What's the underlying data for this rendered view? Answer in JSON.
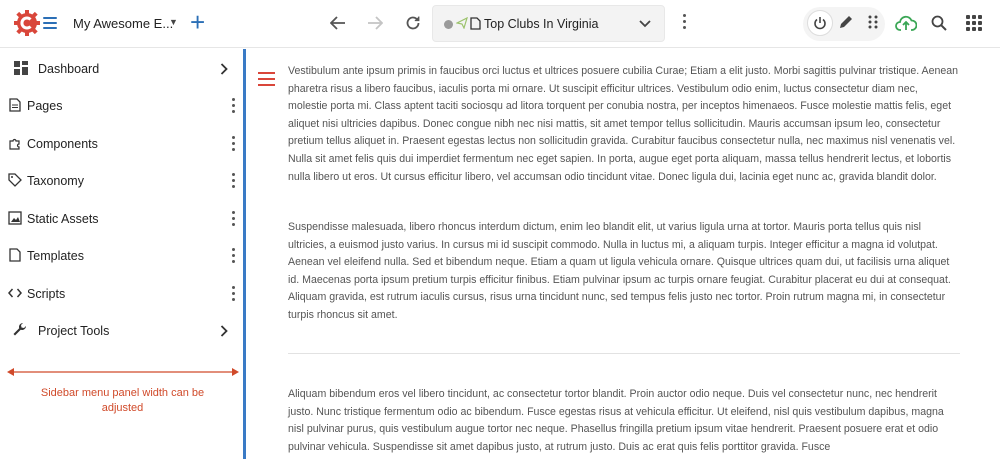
{
  "header": {
    "project_name": "My Awesome E...",
    "url_title": "Top Clubs In Virginia"
  },
  "sidebar": {
    "items": [
      {
        "label": "Dashboard",
        "icon": "dashboard-icon",
        "action": "chevron"
      },
      {
        "label": "Pages",
        "icon": "page-icon",
        "action": "kebab"
      },
      {
        "label": "Components",
        "icon": "puzzle-icon",
        "action": "kebab"
      },
      {
        "label": "Taxonomy",
        "icon": "tag-icon",
        "action": "kebab"
      },
      {
        "label": "Static Assets",
        "icon": "image-icon",
        "action": "kebab"
      },
      {
        "label": "Templates",
        "icon": "document-icon",
        "action": "kebab"
      },
      {
        "label": "Scripts",
        "icon": "code-icon",
        "action": "kebab"
      },
      {
        "label": "Project Tools",
        "icon": "wrench-icon",
        "action": "chevron"
      }
    ],
    "resize_note": "Sidebar menu panel width can be adjusted"
  },
  "content": {
    "paragraphs": [
      "Vestibulum ante ipsum primis in faucibus orci luctus et ultrices posuere cubilia Curae; Etiam a elit justo. Morbi sagittis pulvinar tristique. Aenean pharetra risus a libero faucibus, iaculis porta mi ornare. Ut suscipit efficitur ultrices. Vestibulum odio enim, luctus consectetur diam nec, molestie porta mi. Class aptent taciti sociosqu ad litora torquent per conubia nostra, per inceptos himenaeos. Fusce molestie mattis felis, eget aliquet nisi ultricies dapibus. Donec congue nibh nec nisi mattis, sit amet tempor tellus sollicitudin. Mauris accumsan ipsum leo, consectetur pretium tellus aliquet in. Praesent egestas lectus non sollicitudin gravida. Curabitur faucibus consectetur nulla, nec maximus nisl venenatis vel. Nulla sit amet felis quis dui imperdiet fermentum nec eget sapien. In porta, augue eget porta aliquam, massa tellus hendrerit lectus, et lobortis nulla libero ut eros. Ut cursus efficitur libero, vel accumsan odio tincidunt vitae. Donec ligula dui, lacinia eget nunc ac, gravida blandit dolor.",
      "Suspendisse malesuada, libero rhoncus interdum dictum, enim leo blandit elit, ut varius ligula urna at tortor. Mauris porta tellus quis nisl ultricies, a euismod justo varius. In cursus mi id suscipit commodo. Nulla in luctus mi, a aliquam turpis. Integer efficitur a magna id volutpat. Aenean vel eleifend nulla. Sed et bibendum neque. Etiam a quam ut ligula vehicula ornare. Quisque ultrices quam dui, ut facilisis urna aliquet id. Maecenas porta ipsum pretium turpis efficitur finibus. Etiam pulvinar ipsum ac turpis ornare feugiat. Curabitur placerat eu dui at consequat. Aliquam gravida, est rutrum iaculis cursus, risus urna tincidunt nunc, sed tempus felis justo nec tortor. Proin rutrum magna mi, in consectetur turpis rhoncus sit amet.",
      "Aliquam bibendum eros vel libero tincidunt, ac consectetur tortor blandit. Proin auctor odio neque. Duis vel consectetur nunc, nec hendrerit justo. Nunc tristique fermentum odio ac bibendum. Fusce egestas risus at vehicula efficitur. Ut eleifend, nisl quis vestibulum dapibus, magna nisl pulvinar purus, quis vestibulum augue tortor nec neque. Phasellus fringilla pretium ipsum vitae hendrerit. Praesent posuere erat et odio pulvinar vehicula. Suspendisse sit amet dapibus justo, at rutrum justo. Duis ac erat quis felis porttitor gravida. Fusce"
    ]
  },
  "colors": {
    "accent": "#2b6fb6",
    "divider": "#3a7ac5",
    "annotation": "#d04a2a",
    "menu_red": "#d9463a",
    "upload_green": "#3aa655"
  }
}
